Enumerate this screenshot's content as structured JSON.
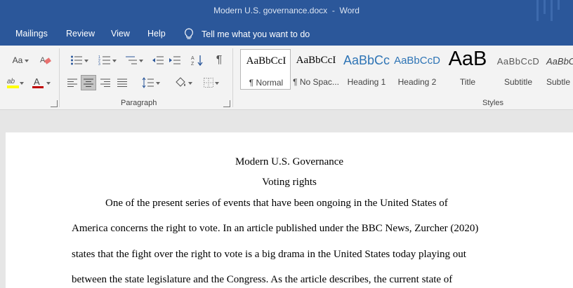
{
  "window": {
    "title": "Modern U.S. governance.docx  -  Word"
  },
  "tabs": [
    "Mailings",
    "Review",
    "View",
    "Help"
  ],
  "tellme": {
    "text": "Tell me what you want to do"
  },
  "ribbon": {
    "font_case_label": "Aa",
    "paragraph_group_label": "Paragraph",
    "styles_group_label": "Styles",
    "highlight_color": "#ffff00",
    "font_color": "#c00000"
  },
  "styles": [
    {
      "sample": "AaBbCcI",
      "name": "¶ Normal",
      "color": "#000000"
    },
    {
      "sample": "AaBbCcI",
      "name": "¶ No Spac...",
      "color": "#000000"
    },
    {
      "sample": "AaBbCc",
      "name": "Heading 1",
      "color": "#2e74b5"
    },
    {
      "sample": "AaBbCcD",
      "name": "Heading 2",
      "color": "#2e74b5"
    },
    {
      "sample": "AaB",
      "name": "Title",
      "color": "#000000"
    },
    {
      "sample": "AaBbCcD",
      "name": "Subtitle",
      "color": "#5a5a5a"
    },
    {
      "sample": "AaBbC",
      "name": "Subtle",
      "color": "#404040"
    }
  ],
  "document": {
    "title": "Modern U.S. Governance",
    "subtitle": "Voting rights",
    "lines": [
      "One of the present series of events that have been ongoing in the United States of",
      "America concerns the right to vote. In an article published under the BBC News, Zurcher (2020)",
      "states that the fight over the right to vote is a big drama in the United States today playing out",
      "between the state legislature and the Congress. As the article describes, the current state of"
    ]
  }
}
